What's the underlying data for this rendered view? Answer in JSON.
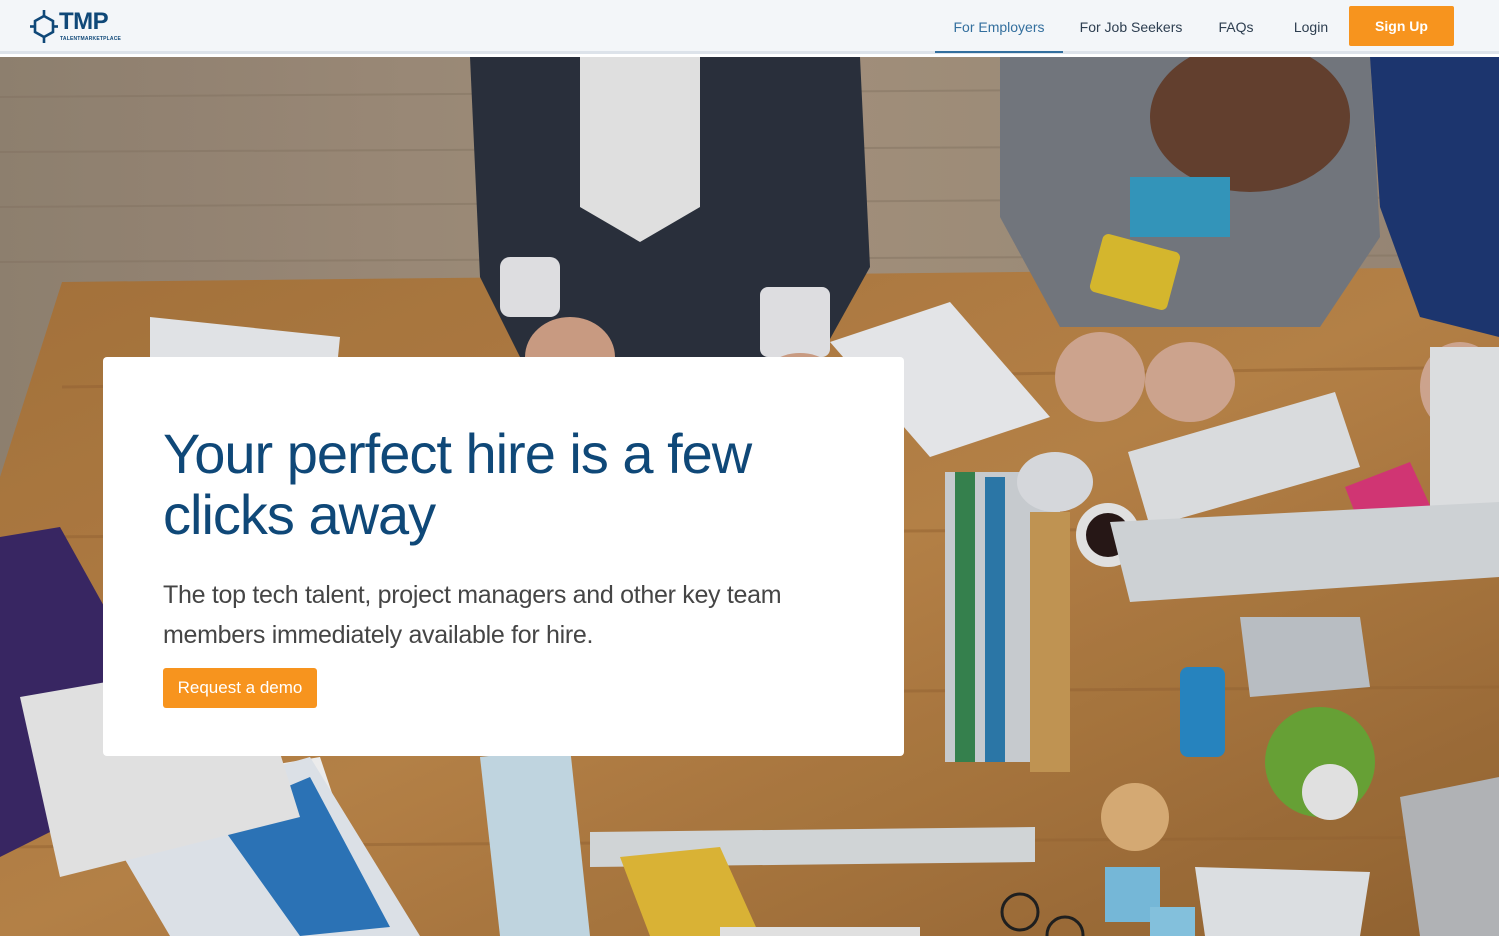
{
  "brand": {
    "logo_text": "TMP",
    "logo_subtext": "TALENTMARKETPLACE",
    "primary_color": "#0f4878",
    "accent_color": "#f7941e"
  },
  "nav": {
    "items": [
      {
        "label": "For Employers",
        "active": true
      },
      {
        "label": "For Job Seekers",
        "active": false
      },
      {
        "label": "FAQs",
        "active": false
      },
      {
        "label": "Login",
        "active": false
      }
    ],
    "signup_label": "Sign Up"
  },
  "hero": {
    "image": "overhead-office-desk-team-photo",
    "headline": "Your perfect hire is a few clicks away",
    "subtext": "The top tech talent, project managers and other key team members immediately available for hire.",
    "cta_label": "Request a demo"
  }
}
